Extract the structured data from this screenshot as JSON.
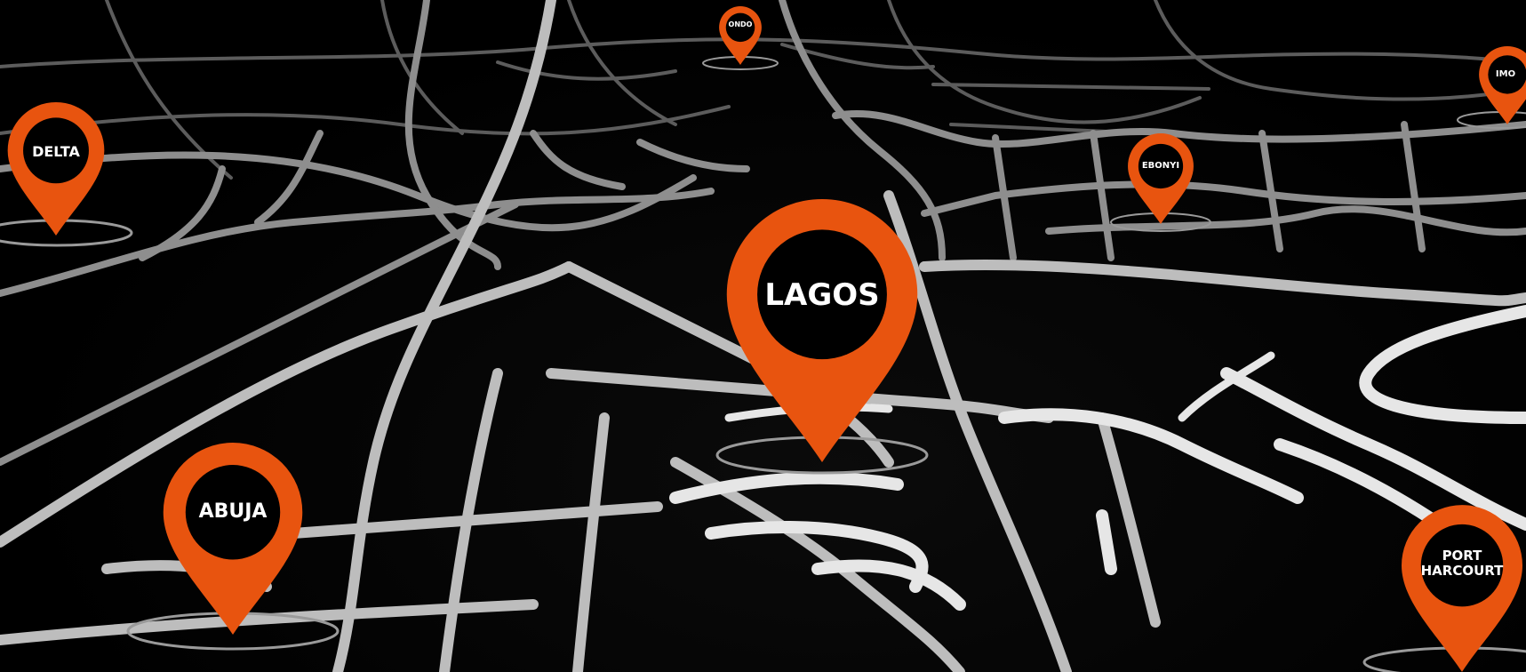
{
  "map": {
    "accent_color": "#e8540f",
    "background_color": "#000000",
    "road_color": "#bdbdbd",
    "markers": [
      {
        "id": "ondo",
        "label": "ONDO",
        "icon": "location-pin-icon"
      },
      {
        "id": "delta",
        "label": "DELTA",
        "icon": "location-pin-icon"
      },
      {
        "id": "imo",
        "label": "IMO",
        "icon": "location-pin-icon"
      },
      {
        "id": "ebonyi",
        "label": "EBONYI",
        "icon": "location-pin-icon"
      },
      {
        "id": "lagos",
        "label": "LAGOS",
        "icon": "location-pin-icon"
      },
      {
        "id": "abuja",
        "label": "ABUJA",
        "icon": "location-pin-icon"
      },
      {
        "id": "port-harcourt",
        "label": "PORT\nHARCOURT",
        "icon": "location-pin-icon"
      }
    ]
  }
}
